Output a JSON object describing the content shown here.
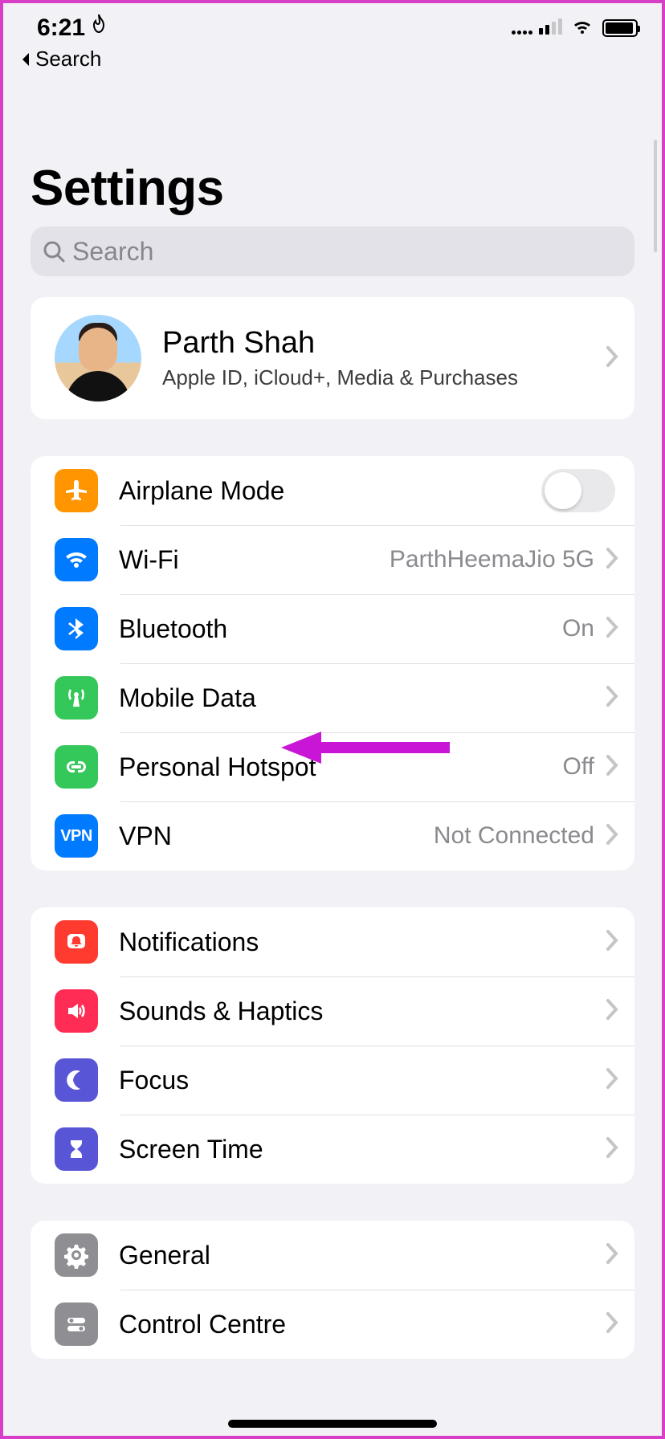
{
  "status": {
    "time": "6:21"
  },
  "back": {
    "label": "Search"
  },
  "title": "Settings",
  "search": {
    "placeholder": "Search"
  },
  "profile": {
    "name": "Parth Shah",
    "subtitle": "Apple ID, iCloud+, Media & Purchases"
  },
  "group1": {
    "airplane": {
      "label": "Airplane Mode"
    },
    "wifi": {
      "label": "Wi-Fi",
      "value": "ParthHeemaJio 5G"
    },
    "bluetooth": {
      "label": "Bluetooth",
      "value": "On"
    },
    "mobile": {
      "label": "Mobile Data"
    },
    "hotspot": {
      "label": "Personal Hotspot",
      "value": "Off"
    },
    "vpn": {
      "label": "VPN",
      "value": "Not Connected",
      "badge": "VPN"
    }
  },
  "group2": {
    "notifications": {
      "label": "Notifications"
    },
    "sounds": {
      "label": "Sounds & Haptics"
    },
    "focus": {
      "label": "Focus"
    },
    "screentime": {
      "label": "Screen Time"
    }
  },
  "group3": {
    "general": {
      "label": "General"
    },
    "control": {
      "label": "Control Centre"
    }
  }
}
